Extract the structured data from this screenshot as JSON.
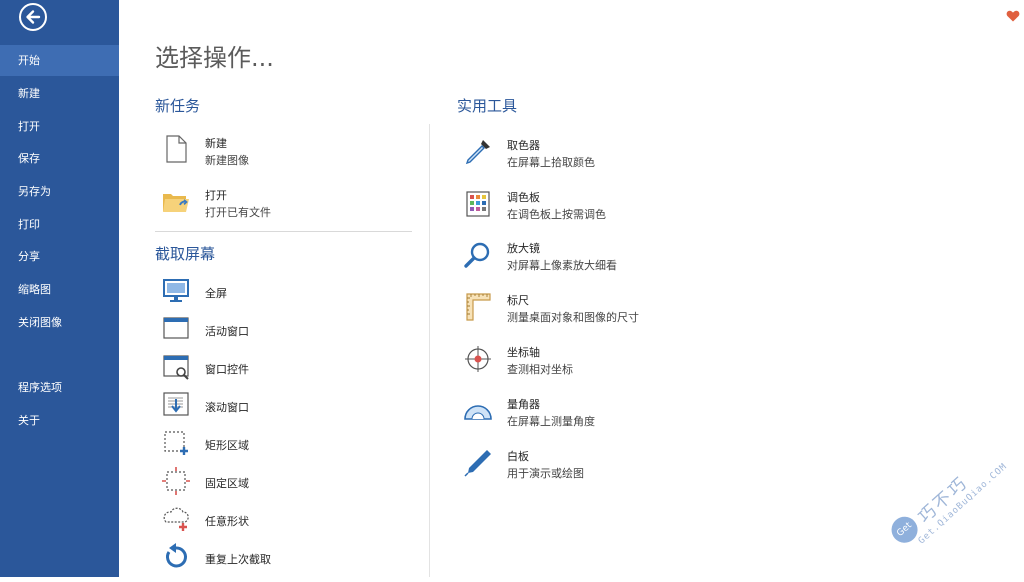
{
  "sidebar": {
    "items": [
      {
        "label": "开始",
        "active": true
      },
      {
        "label": "新建"
      },
      {
        "label": "打开"
      },
      {
        "label": "保存"
      },
      {
        "label": "另存为"
      },
      {
        "label": "打印"
      },
      {
        "label": "分享"
      },
      {
        "label": "缩略图"
      },
      {
        "label": "关闭图像"
      },
      {
        "label": "程序选项"
      },
      {
        "label": "关于"
      }
    ]
  },
  "main": {
    "title": "选择操作...",
    "new_task": {
      "heading": "新任务",
      "items": [
        {
          "title": "新建",
          "desc": "新建图像"
        },
        {
          "title": "打开",
          "desc": "打开已有文件"
        }
      ]
    },
    "capture": {
      "heading": "截取屏幕",
      "items": [
        {
          "label": "全屏"
        },
        {
          "label": "活动窗口"
        },
        {
          "label": "窗口控件"
        },
        {
          "label": "滚动窗口"
        },
        {
          "label": "矩形区域"
        },
        {
          "label": "固定区域"
        },
        {
          "label": "任意形状"
        },
        {
          "label": "重复上次截取"
        }
      ]
    },
    "tools": {
      "heading": "实用工具",
      "items": [
        {
          "title": "取色器",
          "desc": "在屏幕上拾取颜色"
        },
        {
          "title": "调色板",
          "desc": "在调色板上按需调色"
        },
        {
          "title": "放大镜",
          "desc": "对屏幕上像素放大细看"
        },
        {
          "title": "标尺",
          "desc": "测量桌面对象和图像的尺寸"
        },
        {
          "title": "坐标轴",
          "desc": "查测相对坐标"
        },
        {
          "title": "量角器",
          "desc": "在屏幕上测量角度"
        },
        {
          "title": "白板",
          "desc": "用于演示或绘图"
        }
      ]
    }
  },
  "watermark": {
    "main": "巧不巧",
    "sub": "Get.QiaoBuQiao.COM",
    "logo": "Get"
  },
  "colors": {
    "sidebar": "#2b579a",
    "sidebar_active": "#3e6db3",
    "accent": "#2b579a",
    "heart": "#e0603f"
  }
}
